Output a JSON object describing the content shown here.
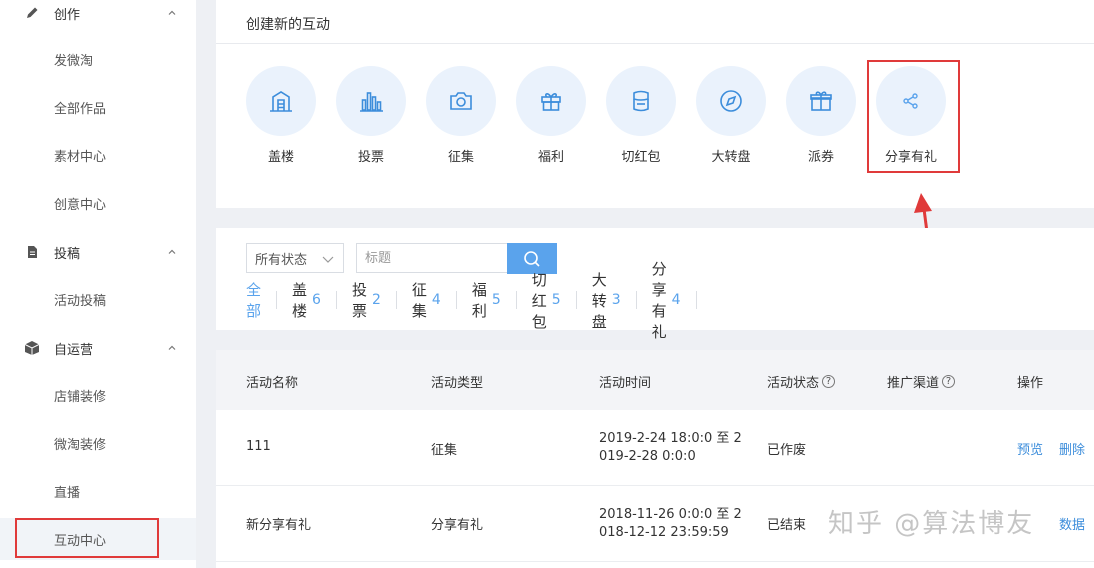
{
  "sidebar": {
    "groups": [
      {
        "label": "创作",
        "icon": "pencil-icon",
        "items": [
          "发微淘",
          "全部作品",
          "素材中心",
          "创意中心"
        ]
      },
      {
        "label": "投稿",
        "icon": "document-icon",
        "items": [
          "活动投稿"
        ]
      },
      {
        "label": "自运营",
        "icon": "box-icon",
        "items": [
          "店铺装修",
          "微淘装修",
          "直播",
          "互动中心"
        ]
      }
    ],
    "active_item": "互动中心"
  },
  "create": {
    "title": "创建新的互动",
    "types": [
      {
        "label": "盖楼",
        "icon": "building-icon"
      },
      {
        "label": "投票",
        "icon": "bar-chart-icon"
      },
      {
        "label": "征集",
        "icon": "camera-icon"
      },
      {
        "label": "福利",
        "icon": "gift-icon"
      },
      {
        "label": "切红包",
        "icon": "red-packet-icon"
      },
      {
        "label": "大转盘",
        "icon": "compass-icon"
      },
      {
        "label": "派券",
        "icon": "coupon-gift-icon"
      },
      {
        "label": "分享有礼",
        "icon": "share-icon"
      }
    ]
  },
  "filter": {
    "status_select": "所有状态",
    "title_placeholder": "标题",
    "tabs": [
      {
        "label": "全部",
        "count": ""
      },
      {
        "label": "盖楼",
        "count": "6"
      },
      {
        "label": "投票",
        "count": "2"
      },
      {
        "label": "征集",
        "count": "4"
      },
      {
        "label": "福利",
        "count": "5"
      },
      {
        "label": "切红包",
        "count": "5"
      },
      {
        "label": "大转盘",
        "count": "3"
      },
      {
        "label": "分享有礼",
        "count": "4"
      }
    ]
  },
  "table": {
    "headers": {
      "name": "活动名称",
      "type": "活动类型",
      "time": "活动时间",
      "status": "活动状态",
      "channel": "推广渠道",
      "ops": "操作"
    },
    "rows": [
      {
        "name": "111",
        "type": "征集",
        "time_line1": "2019-2-24 18:0:0 至 2",
        "time_line2": "019-2-28 0:0:0",
        "status": "已作废",
        "op1": "预览",
        "op2": "删除"
      },
      {
        "name": "新分享有礼",
        "type": "分享有礼",
        "time_line1": "2018-11-26 0:0:0 至 2",
        "time_line2": "018-12-12 23:59:59",
        "status": "已结束",
        "op1": "",
        "op2": "数据"
      }
    ]
  },
  "watermark": "知乎 @算法博友",
  "colors": {
    "accent": "#5aa3ec",
    "link": "#3c8ddb",
    "highlight": "#e03a3a",
    "circle_bg": "#eaf2fc"
  }
}
